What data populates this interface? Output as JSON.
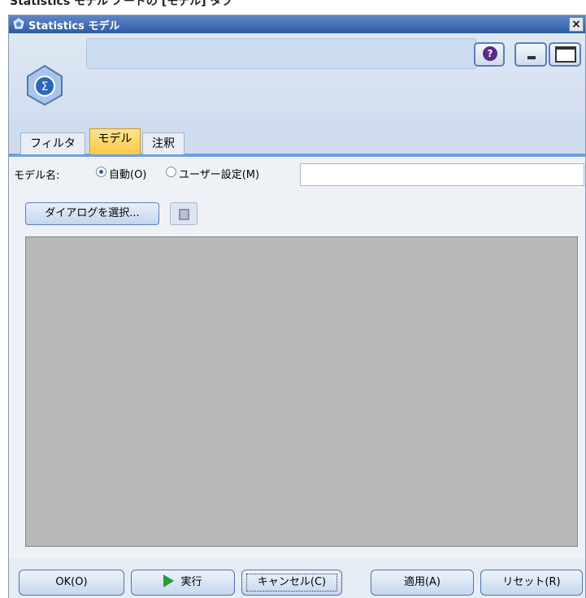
{
  "caption": "Statistics モデル ノードの [モデル] タブ",
  "window": {
    "title": "Statistics モデル",
    "close_label": "×"
  },
  "header": {
    "node_icon_glyph": "Σ",
    "help_glyph": "?",
    "icons": [
      "statistics-node-icon",
      "help-icon",
      "minimize-icon",
      "maximize-icon"
    ]
  },
  "tabs": [
    {
      "label": "フィルタ",
      "active": false
    },
    {
      "label": "モデル",
      "active": true
    },
    {
      "label": "注釈",
      "active": false
    }
  ],
  "model_name": {
    "label": "モデル名:",
    "options": [
      {
        "label": "自動(O)",
        "selected": true
      },
      {
        "label": "ユーザー設定(M)",
        "selected": false
      }
    ],
    "custom_value": ""
  },
  "toolbar": {
    "select_dialog_label": "ダイアログを選択...",
    "delete_icon": "delete-icon"
  },
  "footer": {
    "ok_label": "OK(O)",
    "run_label": "実行",
    "cancel_label": "キャンセル(C)",
    "apply_label": "適用(A)",
    "reset_label": "リセット(R)"
  },
  "colors": {
    "title_bar": "#2f5ba6",
    "active_tab": "#ffc94a",
    "syntax_area": "#b9b9b9",
    "tab_underline": "#6ea1dc"
  }
}
